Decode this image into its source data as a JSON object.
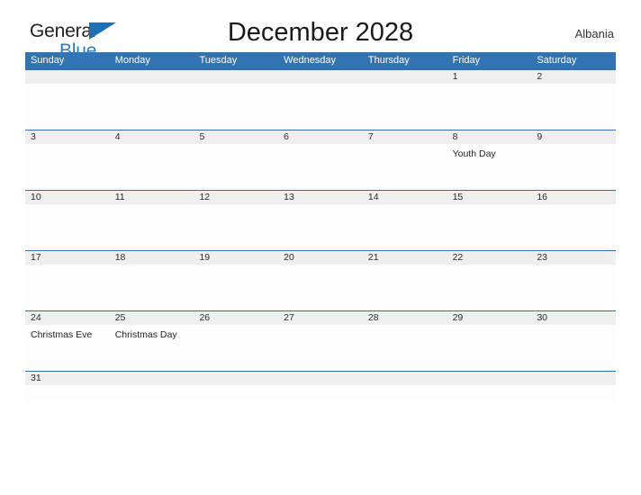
{
  "brand": {
    "word_one": "General",
    "word_two": "Blue",
    "flag_icon": "blue-flag-triangle-icon",
    "accent_color": "#2b7cc4"
  },
  "header": {
    "title": "December 2028",
    "country": "Albania"
  },
  "colors": {
    "header_blue": "#3273b1",
    "row_divider_blue": "#2e70ae",
    "number_strip_gray": "#efefef",
    "text_dark": "#1b1b1b"
  },
  "calendar": {
    "weekday_headers": [
      "Sunday",
      "Monday",
      "Tuesday",
      "Wednesday",
      "Thursday",
      "Friday",
      "Saturday"
    ],
    "weeks": [
      {
        "days": [
          {
            "number": "",
            "event": ""
          },
          {
            "number": "",
            "event": ""
          },
          {
            "number": "",
            "event": ""
          },
          {
            "number": "",
            "event": ""
          },
          {
            "number": "",
            "event": ""
          },
          {
            "number": "1",
            "event": ""
          },
          {
            "number": "2",
            "event": ""
          }
        ]
      },
      {
        "days": [
          {
            "number": "3",
            "event": ""
          },
          {
            "number": "4",
            "event": ""
          },
          {
            "number": "5",
            "event": ""
          },
          {
            "number": "6",
            "event": ""
          },
          {
            "number": "7",
            "event": ""
          },
          {
            "number": "8",
            "event": "Youth Day"
          },
          {
            "number": "9",
            "event": ""
          }
        ]
      },
      {
        "days": [
          {
            "number": "10",
            "event": ""
          },
          {
            "number": "11",
            "event": ""
          },
          {
            "number": "12",
            "event": ""
          },
          {
            "number": "13",
            "event": ""
          },
          {
            "number": "14",
            "event": ""
          },
          {
            "number": "15",
            "event": ""
          },
          {
            "number": "16",
            "event": ""
          }
        ]
      },
      {
        "days": [
          {
            "number": "17",
            "event": ""
          },
          {
            "number": "18",
            "event": ""
          },
          {
            "number": "19",
            "event": ""
          },
          {
            "number": "20",
            "event": ""
          },
          {
            "number": "21",
            "event": ""
          },
          {
            "number": "22",
            "event": ""
          },
          {
            "number": "23",
            "event": ""
          }
        ]
      },
      {
        "days": [
          {
            "number": "24",
            "event": "Christmas Eve"
          },
          {
            "number": "25",
            "event": "Christmas Day"
          },
          {
            "number": "26",
            "event": ""
          },
          {
            "number": "27",
            "event": ""
          },
          {
            "number": "28",
            "event": ""
          },
          {
            "number": "29",
            "event": ""
          },
          {
            "number": "30",
            "event": ""
          }
        ]
      },
      {
        "short": true,
        "days": [
          {
            "number": "31",
            "event": ""
          },
          {
            "number": "",
            "event": ""
          },
          {
            "number": "",
            "event": ""
          },
          {
            "number": "",
            "event": ""
          },
          {
            "number": "",
            "event": ""
          },
          {
            "number": "",
            "event": ""
          },
          {
            "number": "",
            "event": ""
          }
        ]
      }
    ]
  }
}
